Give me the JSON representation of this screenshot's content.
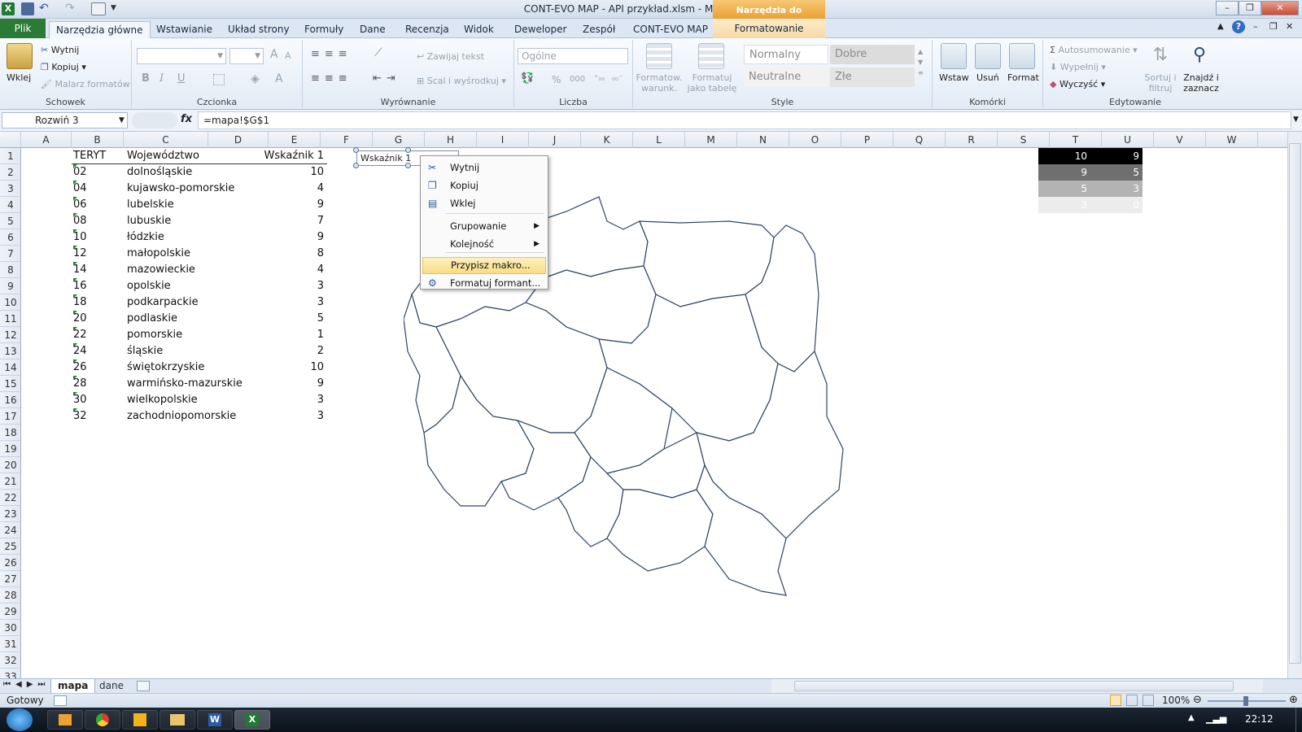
{
  "window": {
    "title": "CONT-EVO MAP - API przykład.xlsm - Microsoft Excel",
    "context_tools": "Narzędzia do rysowania"
  },
  "tabs": [
    "Narzędzia główne",
    "Wstawianie",
    "Układ strony",
    "Formuły",
    "Dane",
    "Recenzja",
    "Widok",
    "Deweloper",
    "Zespół",
    "CONT-EVO MAP"
  ],
  "file_tab": "Plik",
  "format_tab": "Formatowanie",
  "ribbon": {
    "clipboard": {
      "paste": "Wklej",
      "cut": "Wytnij",
      "copy": "Kopiuj",
      "painter": "Malarz formatów",
      "label": "Schowek"
    },
    "font": {
      "label": "Czcionka",
      "bold": "B",
      "italic": "I",
      "underline": "U",
      "grow": "A",
      "shrink": "A",
      "color": "A"
    },
    "align": {
      "label": "Wyrównanie",
      "wrap": "Zawijaj tekst",
      "merge": "Scal i wyśrodkuj"
    },
    "number": {
      "label": "Liczba",
      "format": "Ogólne",
      "percent": "%",
      "thousands": "000"
    },
    "styles": {
      "label": "Style",
      "cond": "Formatow. warunk.",
      "table": "Formatuj jako tabelę",
      "normal": "Normalny",
      "good": "Dobre",
      "neutral": "Neutralne",
      "bad": "Złe"
    },
    "cells": {
      "label": "Komórki",
      "insert": "Wstaw",
      "delete": "Usuń",
      "format": "Format"
    },
    "editing": {
      "label": "Edytowanie",
      "autosum": "Autosumowanie",
      "fill": "Wypełnij",
      "clear": "Wyczyść",
      "sort": "Sortuj i filtruj",
      "find": "Znajdź i zaznacz"
    }
  },
  "formula": {
    "namebox": "Rozwiń 3",
    "fx": "fx",
    "value": "=mapa!$G$1"
  },
  "columns": [
    "A",
    "B",
    "C",
    "D",
    "E",
    "F",
    "G",
    "H",
    "I",
    "J",
    "K",
    "L",
    "M",
    "N",
    "O",
    "P",
    "Q",
    "R",
    "S",
    "T",
    "U",
    "V",
    "W"
  ],
  "rows": [
    "1",
    "2",
    "3",
    "4",
    "5",
    "6",
    "7",
    "8",
    "9",
    "10",
    "11",
    "12",
    "13",
    "14",
    "15",
    "16",
    "17",
    "18",
    "19",
    "20",
    "21",
    "22",
    "23",
    "24",
    "25",
    "26",
    "27",
    "28",
    "29",
    "30",
    "31",
    "32",
    "33"
  ],
  "header": {
    "b": "TERYT",
    "c": "Województwo",
    "d": "Wskaźnik 1"
  },
  "data": [
    [
      "02",
      "dolnośląskie",
      "10"
    ],
    [
      "04",
      "kujawsko-pomorskie",
      "4"
    ],
    [
      "06",
      "lubelskie",
      "9"
    ],
    [
      "08",
      "lubuskie",
      "7"
    ],
    [
      "10",
      "łódzkie",
      "9"
    ],
    [
      "12",
      "małopolskie",
      "8"
    ],
    [
      "14",
      "mazowieckie",
      "4"
    ],
    [
      "16",
      "opolskie",
      "3"
    ],
    [
      "18",
      "podkarpackie",
      "3"
    ],
    [
      "20",
      "podlaskie",
      "5"
    ],
    [
      "22",
      "pomorskie",
      "1"
    ],
    [
      "24",
      "śląskie",
      "2"
    ],
    [
      "26",
      "świętokrzyskie",
      "10"
    ],
    [
      "28",
      "warmińsko-mazurskie",
      "9"
    ],
    [
      "30",
      "wielkopolskie",
      "3"
    ],
    [
      "32",
      "zachodniopomorskie",
      "3"
    ]
  ],
  "legend": [
    [
      "10",
      "9",
      "#000000",
      "#ffffff"
    ],
    [
      "9",
      "5",
      "#6f6f6f",
      "#ffffff"
    ],
    [
      "5",
      "3",
      "#b3b3b3",
      "#ffffff"
    ],
    [
      "3",
      "0",
      "#ececec",
      "#ffffff"
    ]
  ],
  "shape_label": "Wskaźnik 1",
  "context_menu": [
    {
      "label": "Wytnij",
      "icon": "scissors-icon"
    },
    {
      "label": "Kopiuj",
      "icon": "copy-icon"
    },
    {
      "label": "Wklej",
      "icon": "paste-icon"
    },
    {
      "label": "Grupowanie",
      "sub": true
    },
    {
      "label": "Kolejność",
      "sub": true
    },
    {
      "label": "Przypisz makro...",
      "highlight": true
    },
    {
      "label": "Formatuj formant...",
      "icon": "format-control-icon"
    }
  ],
  "sheets": {
    "active": "mapa",
    "other": "dane"
  },
  "status": {
    "ready": "Gotowy",
    "zoom": "100%"
  },
  "clock": "22:12"
}
